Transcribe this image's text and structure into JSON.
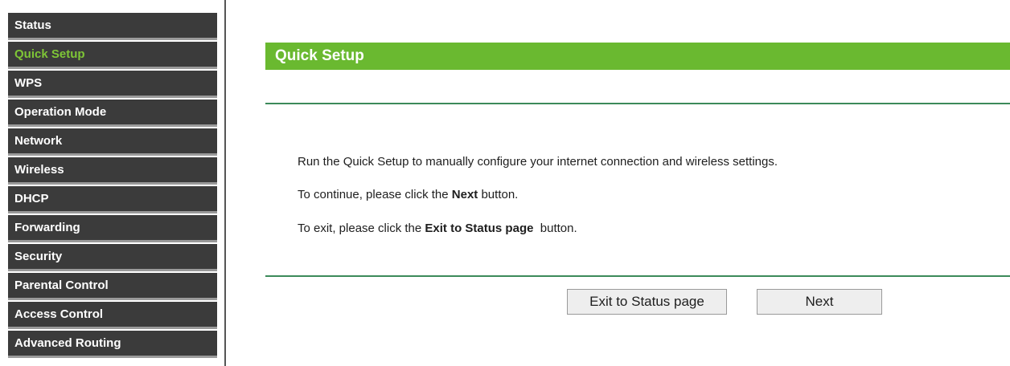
{
  "sidebar": {
    "items": [
      {
        "label": "Status",
        "active": false
      },
      {
        "label": "Quick Setup",
        "active": true
      },
      {
        "label": "WPS",
        "active": false
      },
      {
        "label": "Operation Mode",
        "active": false
      },
      {
        "label": "Network",
        "active": false
      },
      {
        "label": "Wireless",
        "active": false
      },
      {
        "label": "DHCP",
        "active": false
      },
      {
        "label": "Forwarding",
        "active": false
      },
      {
        "label": "Security",
        "active": false
      },
      {
        "label": "Parental Control",
        "active": false
      },
      {
        "label": "Access Control",
        "active": false
      },
      {
        "label": "Advanced Routing",
        "active": false
      }
    ],
    "active_color": "#7ec636"
  },
  "main": {
    "title": "Quick Setup",
    "line1": "Run the Quick Setup to manually configure your internet connection and wireless settings.",
    "line2": {
      "prefix": "To continue, please click the ",
      "bold": "Next",
      "suffix": " button."
    },
    "line3": {
      "prefix": "To exit, please click the ",
      "bold": "Exit to Status page",
      "suffix": "  button."
    },
    "buttons": {
      "exit": "Exit to Status page",
      "next": "Next"
    }
  },
  "colors": {
    "header_green": "#6ab930",
    "menu_bg": "#3b3b3b"
  }
}
